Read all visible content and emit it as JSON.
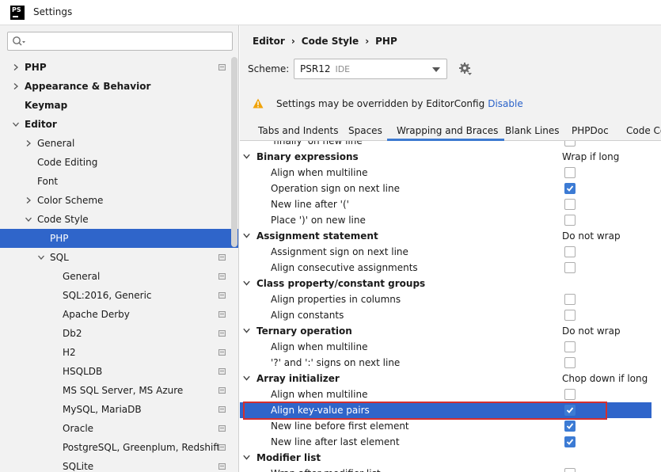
{
  "window": {
    "title": "Settings",
    "logo_text": "PS"
  },
  "sidebar": {
    "search_placeholder": "",
    "items": [
      {
        "label": "PHP",
        "level": 0,
        "arrow": "right",
        "bold": true,
        "project": true
      },
      {
        "label": "Appearance & Behavior",
        "level": 0,
        "arrow": "right",
        "bold": true,
        "project": false
      },
      {
        "label": "Keymap",
        "level": 0,
        "arrow": "none",
        "bold": true,
        "project": false
      },
      {
        "label": "Editor",
        "level": 0,
        "arrow": "down",
        "bold": true,
        "project": false
      },
      {
        "label": "General",
        "level": 1,
        "arrow": "right",
        "bold": false,
        "project": false
      },
      {
        "label": "Code Editing",
        "level": 1,
        "arrow": "none",
        "bold": false,
        "project": false
      },
      {
        "label": "Font",
        "level": 1,
        "arrow": "none",
        "bold": false,
        "project": false
      },
      {
        "label": "Color Scheme",
        "level": 1,
        "arrow": "right",
        "bold": false,
        "project": false
      },
      {
        "label": "Code Style",
        "level": 1,
        "arrow": "down",
        "bold": false,
        "project": false
      },
      {
        "label": "PHP",
        "level": 2,
        "arrow": "none",
        "bold": false,
        "project": false,
        "selected": true
      },
      {
        "label": "SQL",
        "level": 2,
        "arrow": "down",
        "bold": false,
        "project": true
      },
      {
        "label": "General",
        "level": 3,
        "arrow": "none",
        "bold": false,
        "project": true
      },
      {
        "label": "SQL:2016, Generic",
        "level": 3,
        "arrow": "none",
        "bold": false,
        "project": true
      },
      {
        "label": "Apache Derby",
        "level": 3,
        "arrow": "none",
        "bold": false,
        "project": true
      },
      {
        "label": "Db2",
        "level": 3,
        "arrow": "none",
        "bold": false,
        "project": true
      },
      {
        "label": "H2",
        "level": 3,
        "arrow": "none",
        "bold": false,
        "project": true
      },
      {
        "label": "HSQLDB",
        "level": 3,
        "arrow": "none",
        "bold": false,
        "project": true
      },
      {
        "label": "MS SQL Server, MS Azure",
        "level": 3,
        "arrow": "none",
        "bold": false,
        "project": true
      },
      {
        "label": "MySQL, MariaDB",
        "level": 3,
        "arrow": "none",
        "bold": false,
        "project": true
      },
      {
        "label": "Oracle",
        "level": 3,
        "arrow": "none",
        "bold": false,
        "project": true
      },
      {
        "label": "PostgreSQL, Greenplum, Redshift",
        "level": 3,
        "arrow": "none",
        "bold": false,
        "project": true
      },
      {
        "label": "SQLite",
        "level": 3,
        "arrow": "none",
        "bold": false,
        "project": true
      }
    ]
  },
  "main": {
    "breadcrumb": [
      "Editor",
      "Code Style",
      "PHP"
    ],
    "scheme_label": "Scheme:",
    "scheme_value": "PSR12",
    "scheme_sub": "IDE",
    "warning_text": "Settings may be overridden by EditorConfig",
    "warning_link": "Disable",
    "tabs": [
      "Tabs and Indents",
      "Spaces",
      "Wrapping and Braces",
      "Blank Lines",
      "PHPDoc",
      "Code Co"
    ],
    "active_tab": 2,
    "rows": [
      {
        "type": "option",
        "label": "'finally' on new line",
        "checked": false,
        "partial": true
      },
      {
        "type": "group",
        "label": "Binary expressions",
        "value": "Wrap if long"
      },
      {
        "type": "option",
        "label": "Align when multiline",
        "checked": false
      },
      {
        "type": "option",
        "label": "Operation sign on next line",
        "checked": true
      },
      {
        "type": "option",
        "label": "New line after '('",
        "checked": false
      },
      {
        "type": "option",
        "label": "Place ')' on new line",
        "checked": false
      },
      {
        "type": "group",
        "label": "Assignment statement",
        "value": "Do not wrap"
      },
      {
        "type": "option",
        "label": "Assignment sign on next line",
        "checked": false
      },
      {
        "type": "option",
        "label": "Align consecutive assignments",
        "checked": false
      },
      {
        "type": "group",
        "label": "Class property/constant groups",
        "value": ""
      },
      {
        "type": "option",
        "label": "Align properties in columns",
        "checked": false
      },
      {
        "type": "option",
        "label": "Align constants",
        "checked": false
      },
      {
        "type": "group",
        "label": "Ternary operation",
        "value": "Do not wrap"
      },
      {
        "type": "option",
        "label": "Align when multiline",
        "checked": false
      },
      {
        "type": "option",
        "label": "'?' and ':' signs on next line",
        "checked": false
      },
      {
        "type": "group",
        "label": "Array initializer",
        "value": "Chop down if long"
      },
      {
        "type": "option",
        "label": "Align when multiline",
        "checked": false
      },
      {
        "type": "option",
        "label": "Align key-value pairs",
        "checked": true,
        "highlight": true
      },
      {
        "type": "option",
        "label": "New line before first element",
        "checked": true
      },
      {
        "type": "option",
        "label": "New line after last element",
        "checked": true
      },
      {
        "type": "group",
        "label": "Modifier list",
        "value": ""
      },
      {
        "type": "option",
        "label": "Wrap after modifier list",
        "checked": false,
        "partial": true
      }
    ]
  },
  "colors": {
    "accent": "#2f65ca",
    "checkbox": "#3c7bd4",
    "link": "#2a62c9",
    "warning": "#f0a30a",
    "highlight_border": "#d32f2f"
  },
  "icons": [
    "search-icon",
    "gear-icon",
    "warning-icon",
    "chevron-right-icon",
    "chevron-down-icon",
    "check-icon",
    "project-level-icon"
  ]
}
